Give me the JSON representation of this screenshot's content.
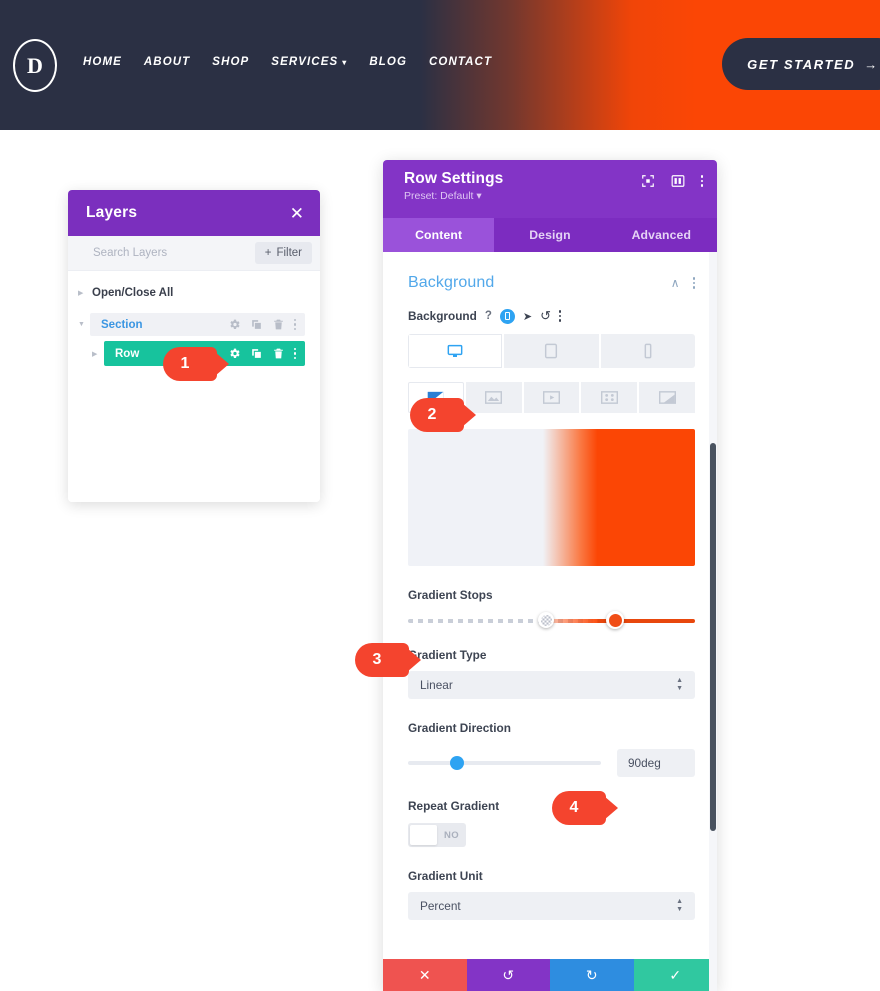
{
  "site_header": {
    "logo_letter": "D",
    "nav_items": [
      {
        "label": "HOME",
        "has_caret": false
      },
      {
        "label": "ABOUT",
        "has_caret": false
      },
      {
        "label": "SHOP",
        "has_caret": false
      },
      {
        "label": "SERVICES",
        "has_caret": true
      },
      {
        "label": "BLOG",
        "has_caret": false
      },
      {
        "label": "CONTACT",
        "has_caret": false
      }
    ],
    "cta_label": "GET STARTED",
    "cta_arrow": "→",
    "bg_color": "#2b3044",
    "accent_color": "#fb4605"
  },
  "layers_panel": {
    "title": "Layers",
    "close_label": "✕",
    "search_placeholder": "Search Layers",
    "filter_label": "Filter",
    "filter_plus": "+",
    "tree": [
      {
        "label": "Open/Close All",
        "type": "root"
      },
      {
        "label": "Section",
        "type": "section"
      },
      {
        "label": "Row",
        "type": "row"
      }
    ],
    "header_color": "#7b2fbe",
    "row_highlight_color": "#17c39d"
  },
  "settings_panel": {
    "title": "Row Settings",
    "preset": "Preset: Default",
    "preset_caret": "▾",
    "tabs": [
      {
        "label": "Content",
        "active": true
      },
      {
        "label": "Design",
        "active": false
      },
      {
        "label": "Advanced",
        "active": false
      }
    ],
    "header_color": "#8334c6",
    "section": {
      "title": "Background",
      "field_label": "Background",
      "help_glyph": "?",
      "undo_glyph": "↺",
      "chevron_glyph": "∧"
    },
    "device_tabs": [
      {
        "name": "desktop",
        "active": true
      },
      {
        "name": "tablet",
        "active": false
      },
      {
        "name": "phone",
        "active": false
      }
    ],
    "background_types": [
      {
        "name": "gradient",
        "active": true
      },
      {
        "name": "image",
        "active": false
      },
      {
        "name": "video",
        "active": false
      },
      {
        "name": "pattern",
        "active": false
      },
      {
        "name": "mask",
        "active": false
      }
    ],
    "gradient_preview": {
      "start_color": "#f0f2f7",
      "end_color": "#fb4605"
    },
    "fields": {
      "gradient_stops_label": "Gradient Stops",
      "gradient_type_label": "Gradient Type",
      "gradient_type_value": "Linear",
      "gradient_direction_label": "Gradient Direction",
      "gradient_direction_value": "90deg",
      "repeat_gradient_label": "Repeat Gradient",
      "repeat_gradient_value": "NO",
      "gradient_unit_label": "Gradient Unit",
      "gradient_unit_value": "Percent"
    },
    "footer": {
      "close_glyph": "✕",
      "undo_glyph": "↺",
      "redo_glyph": "↻",
      "save_glyph": "✓",
      "close_color": "#ef5350",
      "undo_color": "#8334c6",
      "redo_color": "#2e8de0",
      "save_color": "#30c8a0"
    }
  },
  "markers": [
    {
      "number": "1",
      "target": "layers-row-gear"
    },
    {
      "number": "2",
      "target": "gradient-background-type-tab"
    },
    {
      "number": "3",
      "target": "gradient-stops-slider"
    },
    {
      "number": "4",
      "target": "gradient-direction-input"
    }
  ]
}
